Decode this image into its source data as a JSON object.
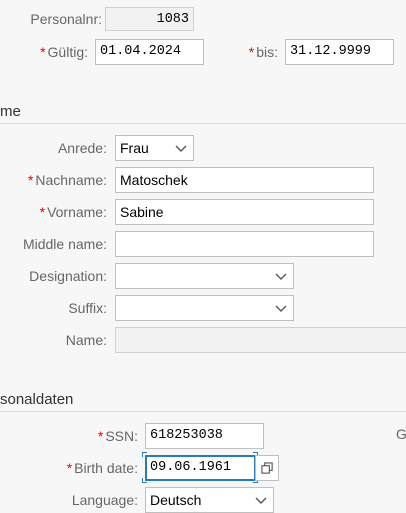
{
  "header": {
    "personalnr_label": "Personalnr:",
    "personalnr_value": "1083",
    "valid_from_label": "Gültig:",
    "valid_from_value": "01.04.2024",
    "valid_to_label": "bis:",
    "valid_to_value": "31.12.9999"
  },
  "name_section": {
    "title": "me",
    "salutation_label": "Anrede:",
    "salutation_value": "Frau",
    "last_name_label": "Nachname:",
    "last_name_value": "Matoschek",
    "first_name_label": "Vorname:",
    "first_name_value": "Sabine",
    "middle_name_label": "Middle name:",
    "middle_name_value": "",
    "designation_label": "Designation:",
    "designation_value": "",
    "suffix_label": "Suffix:",
    "suffix_value": "",
    "full_name_label": "Name:",
    "full_name_value": ""
  },
  "personal_section": {
    "title": "sonaldaten",
    "ssn_label": "SSN:",
    "ssn_value": "618253038",
    "birth_date_label": "Birth date:",
    "birth_date_value": "09.06.1961",
    "language_label": "Language:",
    "language_value": "Deutsch",
    "right_col_fragment": "G"
  },
  "colors": {
    "required": "#e00000",
    "focus": "#2a7ab8"
  },
  "icons": {
    "dropdown": "chevron-down-icon",
    "value_help": "value-help-icon"
  }
}
